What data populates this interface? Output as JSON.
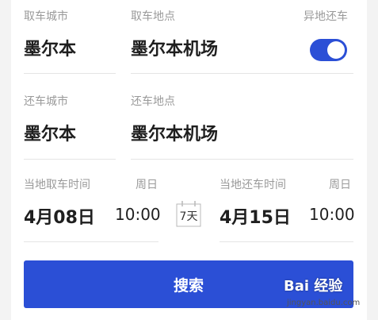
{
  "pickup": {
    "city_label": "取车城市",
    "city_value": "墨尔本",
    "location_label": "取车地点",
    "location_value": "墨尔本机场"
  },
  "one_way": {
    "label": "异地还车",
    "enabled": true
  },
  "return": {
    "city_label": "还车城市",
    "city_value": "墨尔本",
    "location_label": "还车地点",
    "location_value": "墨尔本机场"
  },
  "pickup_time": {
    "label": "当地取车时间",
    "weekday": "周日",
    "date": "4月08日",
    "time": "10:00"
  },
  "duration": {
    "label": "7天"
  },
  "return_time": {
    "label": "当地还车时间",
    "weekday": "周日",
    "date": "4月15日",
    "time": "10:00"
  },
  "search_button": {
    "label": "搜索"
  },
  "watermark": {
    "brand": "Bai 经验",
    "url": "jingyan.baidu.com"
  },
  "colors": {
    "accent": "#2b4fd6",
    "label_gray": "#9a9a9a",
    "text_dark": "#1f1f1f"
  }
}
